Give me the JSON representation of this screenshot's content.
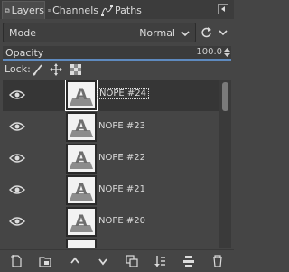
{
  "tabs": [
    {
      "label": "Layers",
      "icon": "layers-icon",
      "active": true
    },
    {
      "label": "Channels",
      "icon": "channels-icon",
      "active": false
    },
    {
      "label": "Paths",
      "icon": "paths-icon",
      "active": false
    }
  ],
  "mode": {
    "label": "Mode",
    "value": "Normal"
  },
  "opacity": {
    "label": "Opacity",
    "value": "100.0"
  },
  "lock": {
    "label": "Lock:",
    "icons": [
      "lock-pixels-icon",
      "lock-position-icon",
      "lock-alpha-icon"
    ]
  },
  "layers": [
    {
      "name": "NOPE #24",
      "visible": true,
      "selected": true
    },
    {
      "name": "NOPE #23",
      "visible": true,
      "selected": false
    },
    {
      "name": "NOPE #22",
      "visible": true,
      "selected": false
    },
    {
      "name": "NOPE #21",
      "visible": true,
      "selected": false
    },
    {
      "name": "NOPE #20",
      "visible": true,
      "selected": false
    },
    {
      "name": "",
      "visible": true,
      "selected": false
    }
  ],
  "toolbar": [
    "new-layer-icon",
    "new-layer-group-icon",
    "raise-layer-icon",
    "lower-layer-icon",
    "duplicate-layer-icon",
    "merge-layer-icon",
    "anchor-layer-icon",
    "delete-layer-icon"
  ],
  "colors": {
    "accent": "#5e8abf",
    "panel_bg": "#454545",
    "selected_row": "#363636"
  }
}
